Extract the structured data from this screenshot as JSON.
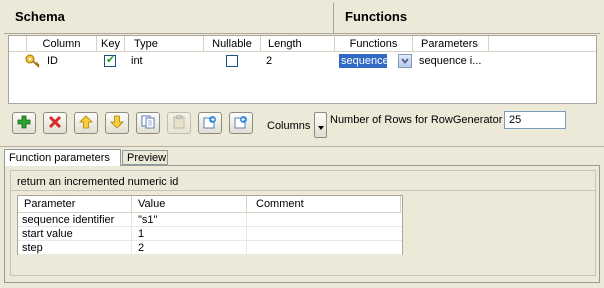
{
  "header": {
    "schema_title": "Schema",
    "functions_title": "Functions"
  },
  "grid": {
    "columns": [
      "Column",
      "Key",
      "Type",
      "Nullable",
      "Length",
      "Functions",
      "Parameters"
    ],
    "row": {
      "column": "ID",
      "key": true,
      "type": "int",
      "nullable": false,
      "length": "2",
      "function": "sequence",
      "parameters": "sequence i..."
    }
  },
  "toolbar": {
    "buttons": [
      "add-icon",
      "remove-icon",
      "move-up-icon",
      "move-down-icon",
      "copy-icon",
      "paste-icon",
      "import-icon",
      "export-icon"
    ],
    "columns_label": "Columns",
    "rows_label": "Number of Rows for RowGenerator",
    "rows_value": "25"
  },
  "tabs": [
    "Function parameters",
    "Preview"
  ],
  "function_panel": {
    "description": "return an incremented numeric id",
    "param_columns": [
      "Parameter",
      "Value",
      "Comment"
    ],
    "params": [
      {
        "name": "sequence identifier",
        "value": "\"s1\"",
        "comment": ""
      },
      {
        "name": "start value",
        "value": "1",
        "comment": ""
      },
      {
        "name": "step",
        "value": "2",
        "comment": ""
      }
    ]
  },
  "colors": {
    "background": "#ece9d8",
    "selection": "#316ac5",
    "add": "#2ea32e",
    "remove": "#d62b2b",
    "arrow": "#e8b820"
  }
}
